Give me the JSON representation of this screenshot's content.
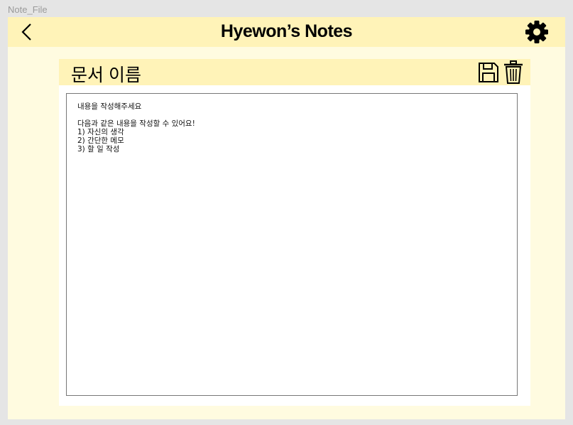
{
  "frame_label": "Note_File",
  "header": {
    "title": "Hyewon’s Notes",
    "back_icon": "chevron-left-icon",
    "settings_icon": "gear-icon"
  },
  "document": {
    "name": "문서 이름",
    "save_icon": "floppy-disk-icon",
    "delete_icon": "trash-icon",
    "content": "내용을 작성해주세요\n\n다음과 같은 내용을 작성할 수 있어요!\n1) 자신의 생각\n2) 간단한 메모\n3) 할 일 작성"
  },
  "colors": {
    "header": "#fff3b8",
    "body": "#fffbe0",
    "background": "#e5e5e5"
  }
}
